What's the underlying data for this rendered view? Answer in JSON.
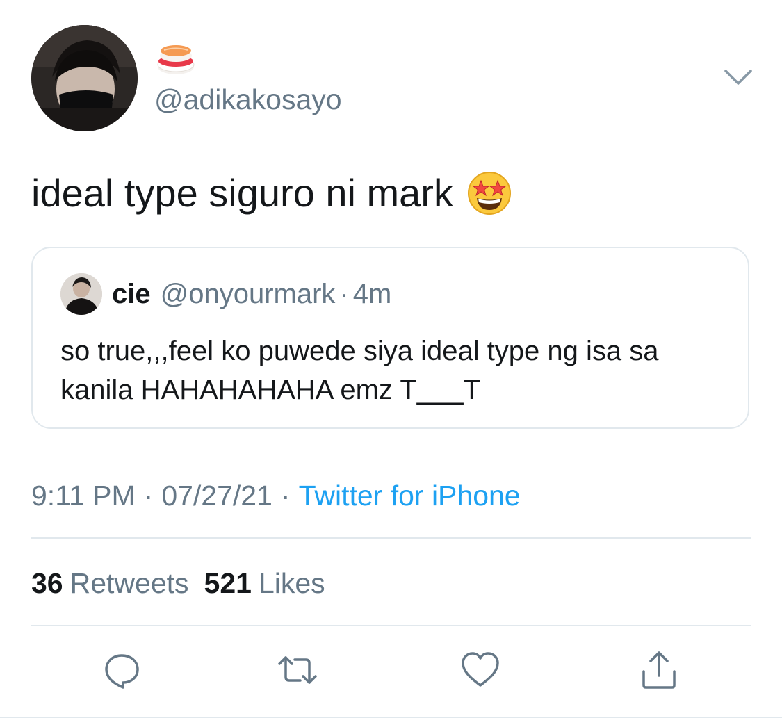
{
  "author": {
    "display_name_icon": "sushi-emoji",
    "handle": "@adikakosayo"
  },
  "tweet": {
    "text": "ideal type siguro ni mark",
    "emoji_icon": "star-struck-emoji"
  },
  "quoted_tweet": {
    "name": "cie",
    "handle": "@onyourmark",
    "separator": "·",
    "time": "4m",
    "text": "so true,,,feel ko puwede siya ideal type ng isa sa kanila HAHAHAHAHA emz T___T"
  },
  "meta": {
    "time": "9:11 PM",
    "separator": "·",
    "date": "07/27/21",
    "source": "Twitter for iPhone"
  },
  "stats": {
    "retweets_count": "36",
    "retweets_label": "Retweets",
    "likes_count": "521",
    "likes_label": "Likes"
  },
  "actions": [
    "reply-icon",
    "retweet-icon",
    "like-icon",
    "share-icon"
  ],
  "colors": {
    "text": "#14171a",
    "secondary": "#657786",
    "link": "#1da1f2",
    "border": "#e1e8ed"
  }
}
